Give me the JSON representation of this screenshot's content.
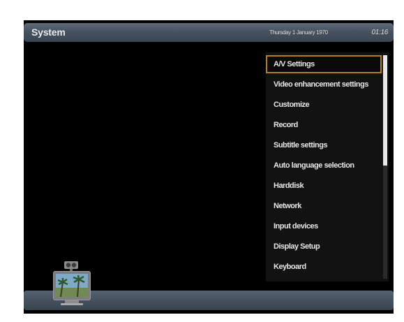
{
  "header": {
    "title": "System",
    "date": "Thursday 1 January 1970",
    "time": "01:16"
  },
  "menu": {
    "items": [
      {
        "label": "A/V Settings",
        "selected": true
      },
      {
        "label": "Video enhancement settings",
        "selected": false
      },
      {
        "label": "Customize",
        "selected": false
      },
      {
        "label": "Record",
        "selected": false
      },
      {
        "label": "Subtitle settings",
        "selected": false
      },
      {
        "label": "Auto language selection",
        "selected": false
      },
      {
        "label": "Harddisk",
        "selected": false
      },
      {
        "label": "Network",
        "selected": false
      },
      {
        "label": "Input devices",
        "selected": false
      },
      {
        "label": "Display Setup",
        "selected": false
      },
      {
        "label": "Keyboard",
        "selected": false
      }
    ]
  },
  "icons": {
    "preview": "tv-set-icon"
  },
  "colors": {
    "selection_border": "#b77c1b",
    "header_bar": "#4a5663",
    "background": "#000000"
  }
}
